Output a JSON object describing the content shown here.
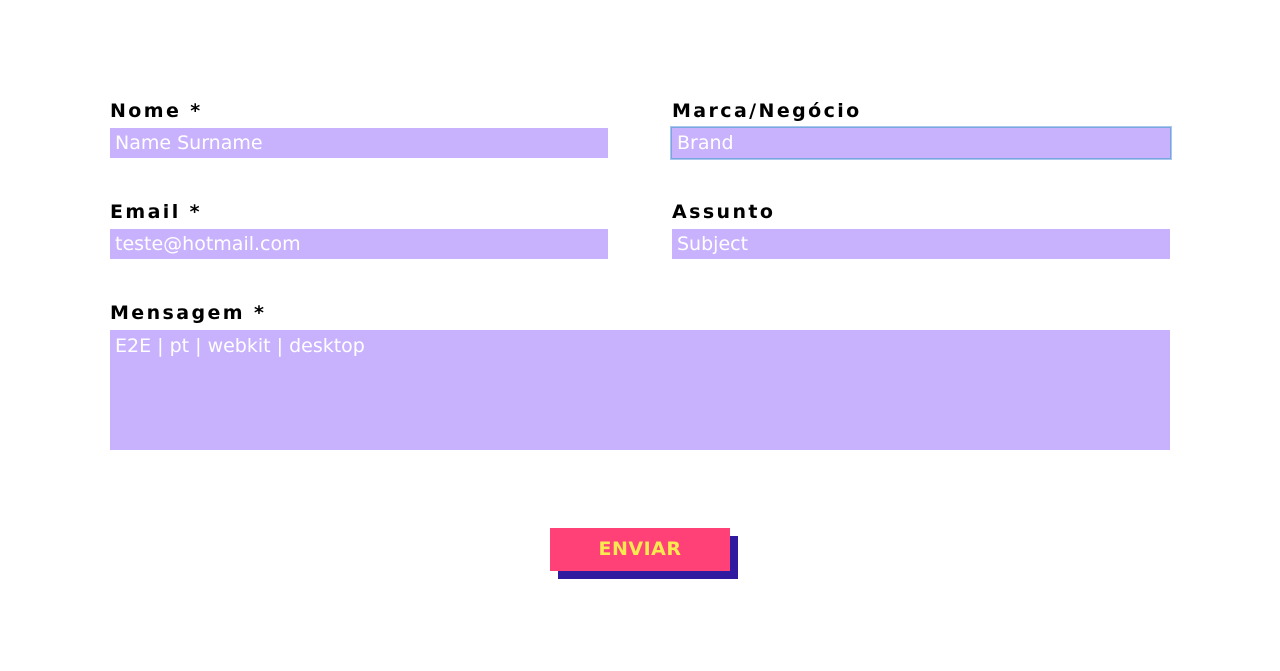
{
  "form": {
    "nome": {
      "label": "Nome *",
      "placeholder": "Name Surname"
    },
    "marca": {
      "label": "Marca/Negócio",
      "placeholder": "Brand"
    },
    "email": {
      "label": "Email *",
      "placeholder": "teste@hotmail.com"
    },
    "assunto": {
      "label": "Assunto",
      "placeholder": "Subject"
    },
    "mensagem": {
      "label": "Mensagem *",
      "placeholder": "E2E | pt | webkit | desktop"
    },
    "submit_label": "ENVIAR"
  },
  "colors": {
    "input_bg": "#c9b2fd",
    "button_bg": "#ff4178",
    "button_text": "#f7e94f",
    "button_shadow": "#2f1aa0",
    "focus_ring": "#7aa6e0"
  }
}
